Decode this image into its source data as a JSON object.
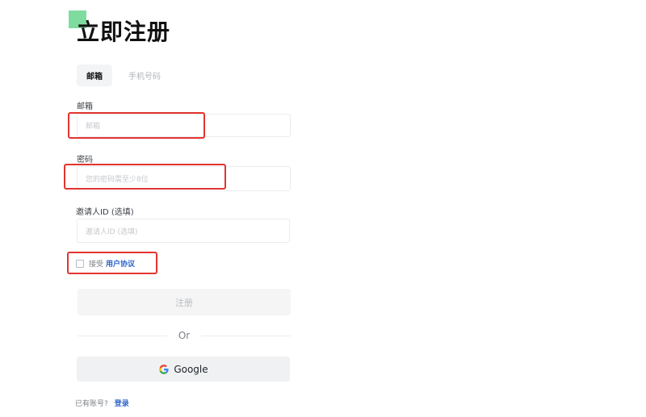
{
  "header": {
    "title": "立即注册"
  },
  "tabs": [
    {
      "label": "邮箱",
      "active": true
    },
    {
      "label": "手机号码",
      "active": false
    }
  ],
  "form": {
    "email": {
      "label": "邮箱",
      "placeholder": "邮箱"
    },
    "password": {
      "label": "密码",
      "placeholder": "您的密码需至少8位"
    },
    "referral": {
      "label": "邀请人ID (选填)",
      "placeholder": "邀请人ID (选填)"
    },
    "agreement": {
      "text": "接受",
      "link": "用户协议",
      "checked": false
    },
    "register_label": "注册",
    "divider_label": "Or",
    "google_label": "Google"
  },
  "footer": {
    "question": "已有账号?",
    "login_link": "登录"
  },
  "colors": {
    "logo": "#7fdc9f",
    "highlight": "#e3342f",
    "link": "#2d64c8"
  }
}
